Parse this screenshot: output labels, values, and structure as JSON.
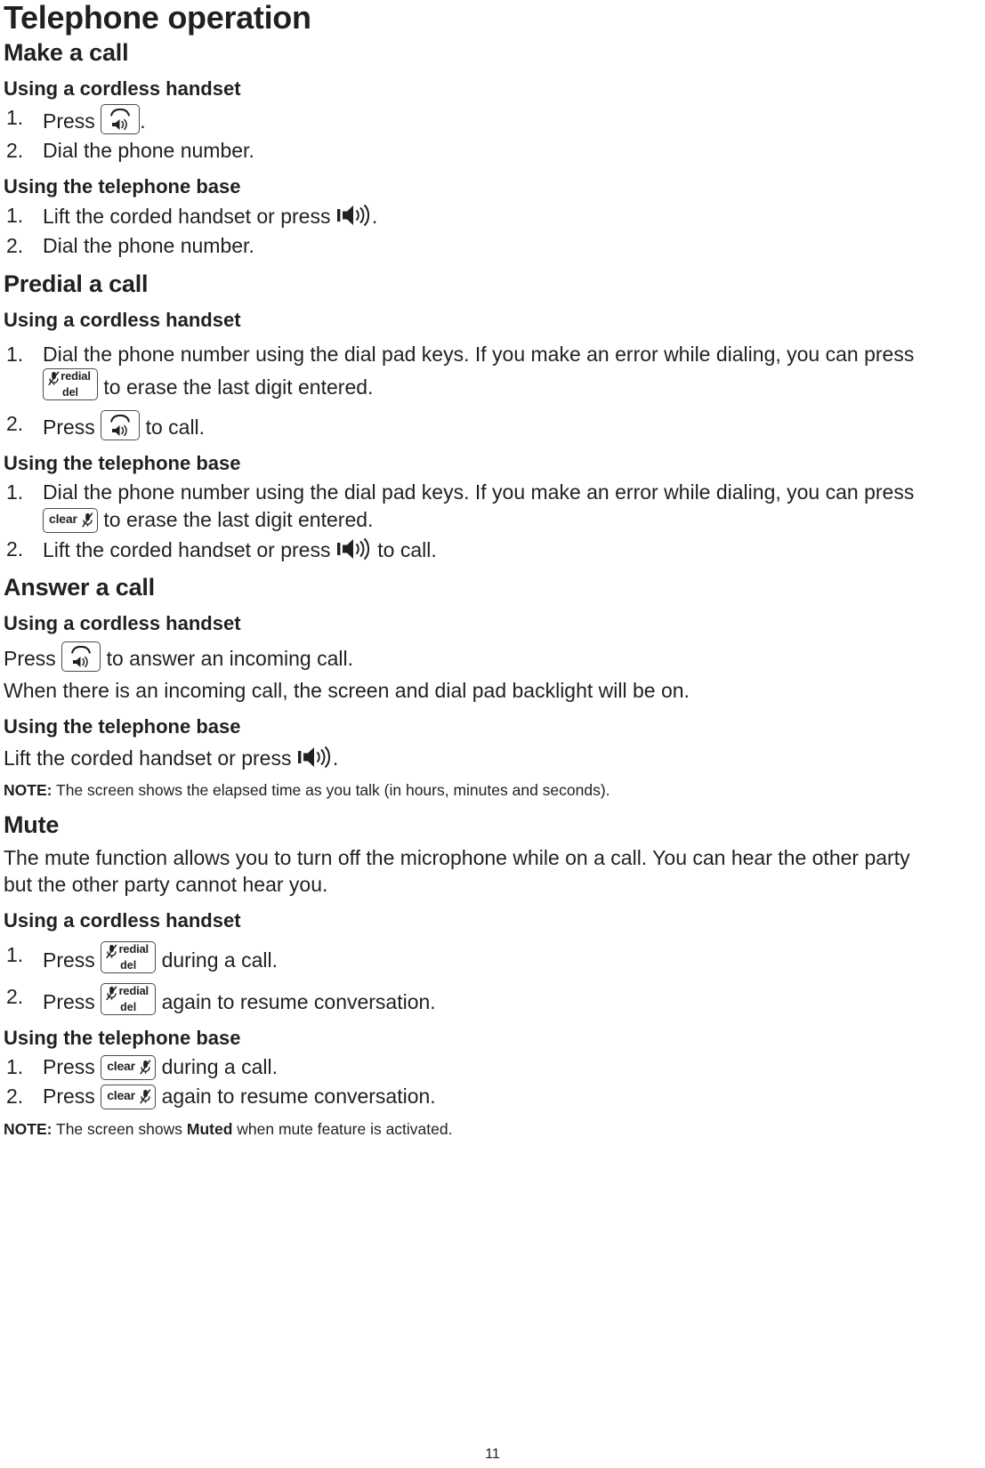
{
  "document": {
    "title": "Telephone operation",
    "page_number": "11"
  },
  "sections": [
    {
      "heading": "Make a call",
      "blocks": [
        {
          "type": "subheading",
          "text": "Using a cordless handset"
        },
        {
          "type": "steps",
          "items": [
            {
              "pre": "Press ",
              "icon": "talk-key",
              "post": "."
            },
            {
              "pre": "Dial the phone number.",
              "icon": null,
              "post": ""
            }
          ]
        },
        {
          "type": "subheading",
          "text": "Using the telephone base"
        },
        {
          "type": "steps",
          "items": [
            {
              "pre": "Lift the corded handset or press ",
              "icon": "speaker-icon",
              "post": "."
            },
            {
              "pre": "Dial the phone number.",
              "icon": null,
              "post": ""
            }
          ]
        }
      ]
    },
    {
      "heading": "Predial a call",
      "blocks": [
        {
          "type": "subheading",
          "text": "Using a cordless handset"
        },
        {
          "type": "steps",
          "items": [
            {
              "pre": "Dial the phone number using the dial pad keys. If you make an error while dialing, you can press ",
              "icon": "redial-del-key",
              "post": " to erase the last digit entered."
            },
            {
              "pre": "Press ",
              "icon": "talk-key",
              "post": " to call."
            }
          ]
        },
        {
          "type": "subheading",
          "text": "Using the telephone base"
        },
        {
          "type": "steps",
          "items": [
            {
              "pre": "Dial the phone number using the dial pad keys. If you make an error while dialing, you can press ",
              "icon": "clear-key",
              "post": " to erase the last digit entered."
            },
            {
              "pre": "Lift the corded handset or press ",
              "icon": "speaker-icon",
              "post": " to call."
            }
          ]
        }
      ]
    },
    {
      "heading": "Answer a call",
      "blocks": [
        {
          "type": "subheading",
          "text": "Using a cordless handset"
        },
        {
          "type": "paragraph_icon",
          "pre": "Press ",
          "icon": "talk-key",
          "post": " to answer an incoming call."
        },
        {
          "type": "paragraph",
          "text": "When there is an incoming call, the screen and dial pad backlight will be on."
        },
        {
          "type": "subheading",
          "text": "Using the telephone base"
        },
        {
          "type": "paragraph_icon",
          "pre": "Lift the corded handset or press ",
          "icon": "speaker-icon",
          "post": "."
        },
        {
          "type": "note",
          "label": "NOTE:",
          "text": " The screen shows the elapsed time as you talk (in hours, minutes and seconds)."
        }
      ]
    },
    {
      "heading": "Mute",
      "blocks": [
        {
          "type": "paragraph",
          "text": "The mute function allows you to turn off the microphone while on a call. You can hear the other party but the other party cannot hear you."
        },
        {
          "type": "subheading",
          "text": "Using a cordless handset"
        },
        {
          "type": "steps",
          "items": [
            {
              "pre": "Press ",
              "icon": "redial-del-key",
              "post": " during a call."
            },
            {
              "pre": "Press ",
              "icon": "redial-del-key",
              "post": " again to resume conversation."
            }
          ]
        },
        {
          "type": "subheading",
          "text": "Using the telephone base"
        },
        {
          "type": "steps",
          "items": [
            {
              "pre": "Press ",
              "icon": "clear-key",
              "post": " during a call."
            },
            {
              "pre": "Press ",
              "icon": "clear-key",
              "post": " again to resume conversation."
            }
          ]
        },
        {
          "type": "note",
          "label": "NOTE:",
          "text_before": " The screen shows ",
          "bold": "Muted",
          "text_after": " when mute feature is activated."
        }
      ]
    }
  ],
  "keys": {
    "redial_label": "redial",
    "del_label": "del",
    "clear_label": "clear"
  },
  "colors": {
    "text": "#231f20",
    "key_outline": "#4c4c4c"
  }
}
